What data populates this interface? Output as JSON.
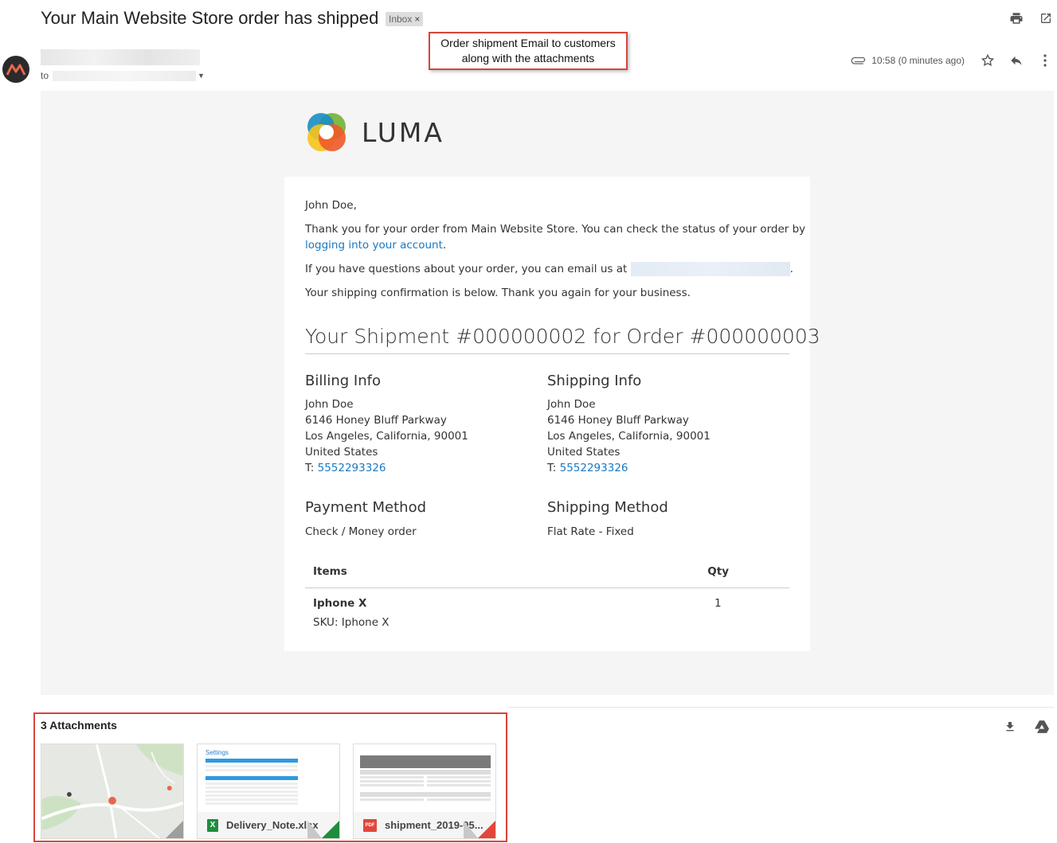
{
  "email": {
    "subject": "Your Main Website Store order has shipped",
    "label_chip": "Inbox",
    "to_label": "to",
    "time": "10:58 (0 minutes ago)"
  },
  "callout": {
    "line1": "Order shipment Email to customers",
    "line2": "along with the attachments"
  },
  "body": {
    "brand": "LUMA",
    "greeting": "John Doe,",
    "thanks_line": "Thank you for your order from Main Website Store. You can check the status of your order by",
    "account_link": "logging into your account",
    "period": ".",
    "questions": "If you have questions about your order, you can email us at",
    "confirmation": "Your shipping confirmation is below. Thank you again for your business.",
    "shipment_title": "Your Shipment #000000002 for Order #000000003"
  },
  "billing": {
    "heading": "Billing Info",
    "name": "John Doe",
    "street": "6146 Honey Bluff Parkway",
    "city": "Los Angeles, California, 90001",
    "country": "United States",
    "phone_prefix": "T:",
    "phone": "5552293326"
  },
  "shipping": {
    "heading": "Shipping Info",
    "name": "John Doe",
    "street": "6146 Honey Bluff Parkway",
    "city": "Los Angeles, California, 90001",
    "country": "United States",
    "phone_prefix": "T:",
    "phone": "5552293326"
  },
  "payment": {
    "heading": "Payment Method",
    "value": "Check / Money order"
  },
  "shipping_method": {
    "heading": "Shipping Method",
    "value": "Flat Rate - Fixed"
  },
  "items": {
    "col_items": "Items",
    "col_qty": "Qty",
    "rows": [
      {
        "name": "Iphone X",
        "sku": "SKU: Iphone X",
        "qty": "1"
      }
    ]
  },
  "attachments": {
    "title": "3 Attachments",
    "files": [
      {
        "name": "",
        "type": "image"
      },
      {
        "name": "Delivery_Note.xlsx",
        "type": "xlsx",
        "badge": "X",
        "color": "#1e8e3e"
      },
      {
        "name": "shipment_2019-05...",
        "type": "pdf",
        "badge": "PDF",
        "color": "#e2463a"
      }
    ],
    "preview_sheet_title": "Settings"
  },
  "colors": {
    "link": "#1979c3",
    "highlight": "#d9433b"
  },
  "icons": [
    "print-icon",
    "open-in-new-icon",
    "paperclip-icon",
    "star-icon",
    "reply-icon",
    "more-vert-icon",
    "download-icon",
    "drive-icon"
  ]
}
